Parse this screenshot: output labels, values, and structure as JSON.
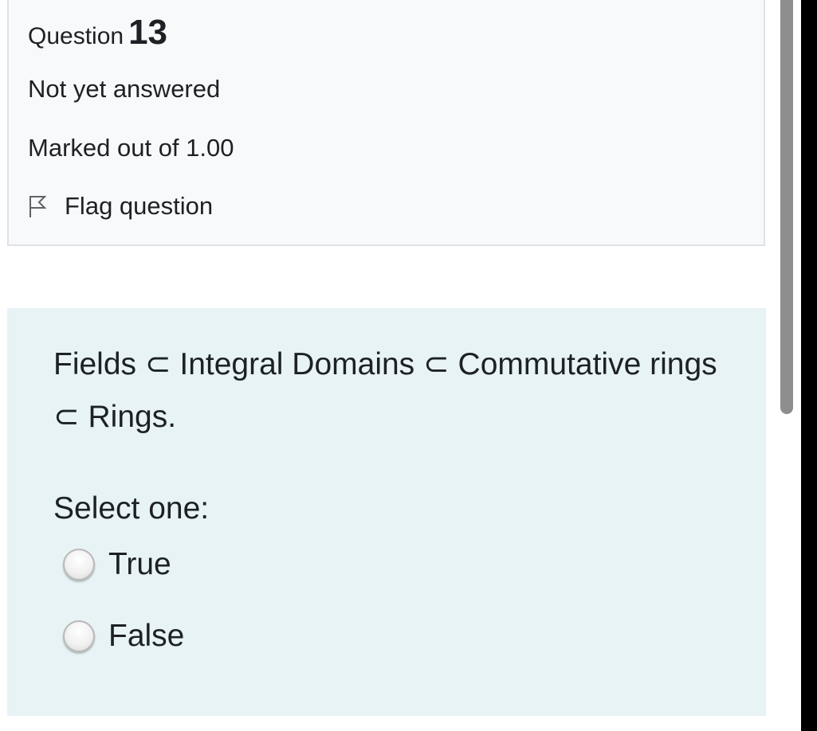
{
  "question": {
    "label": "Question",
    "number": "13",
    "state": "Not yet answered",
    "grade": "Marked out of 1.00",
    "flag_label": "Flag question",
    "flag_icon": "flag-icon"
  },
  "content": {
    "text": "Fields ⊂ Integral Domains ⊂ Commutative rings ⊂ Rings.",
    "prompt": "Select one:",
    "options": [
      {
        "label": "True",
        "selected": false
      },
      {
        "label": "False",
        "selected": false
      }
    ]
  },
  "colors": {
    "info_background": "#f8f9fa",
    "content_background": "#e7f3f5",
    "text": "#1d2125",
    "scrollbar_thumb": "#8e8e8e"
  }
}
